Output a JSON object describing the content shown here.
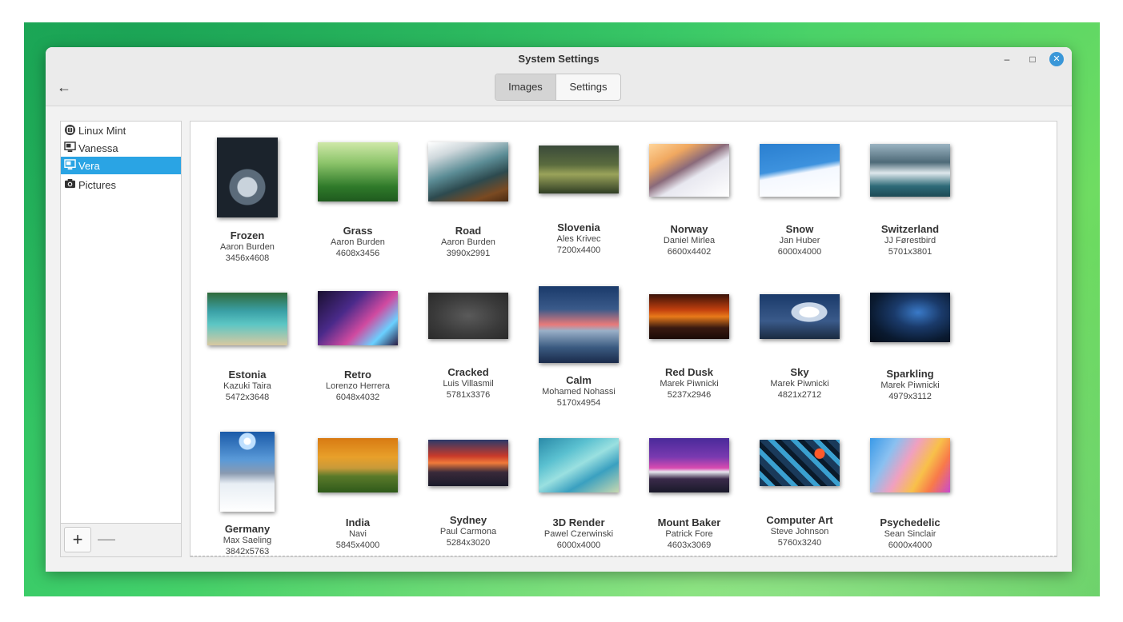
{
  "window": {
    "title": "System Settings",
    "controls": {
      "minimize": "–",
      "maximize": "□",
      "close": "✕"
    },
    "back_icon": "arrow-left-icon"
  },
  "tabs": [
    {
      "label": "Images",
      "active": true
    },
    {
      "label": "Settings",
      "active": false
    }
  ],
  "sidebar": {
    "items": [
      {
        "label": "Linux Mint",
        "icon": "linux-mint-logo-icon",
        "selected": false
      },
      {
        "label": "Vanessa",
        "icon": "monitor-icon",
        "selected": false
      },
      {
        "label": "Vera",
        "icon": "monitor-icon",
        "selected": true
      },
      {
        "label": "Pictures",
        "icon": "camera-icon",
        "selected": false
      }
    ],
    "add_label": "+",
    "remove_label": "—"
  },
  "accent_color": "#2aa4e4",
  "wallpapers": [
    {
      "name": "Frozen",
      "author": "Aaron Burden",
      "size": "3456x4608"
    },
    {
      "name": "Grass",
      "author": "Aaron Burden",
      "size": "4608x3456"
    },
    {
      "name": "Road",
      "author": "Aaron Burden",
      "size": "3990x2991"
    },
    {
      "name": "Slovenia",
      "author": "Ales Krivec",
      "size": "7200x4400"
    },
    {
      "name": "Norway",
      "author": "Daniel Mirlea",
      "size": "6600x4402"
    },
    {
      "name": "Snow",
      "author": "Jan Huber",
      "size": "6000x4000"
    },
    {
      "name": "Switzerland",
      "author": "JJ Førestbird",
      "size": "5701x3801"
    },
    {
      "name": "Estonia",
      "author": "Kazuki Taira",
      "size": "5472x3648"
    },
    {
      "name": "Retro",
      "author": "Lorenzo Herrera",
      "size": "6048x4032"
    },
    {
      "name": "Cracked",
      "author": "Luis Villasmil",
      "size": "5781x3376"
    },
    {
      "name": "Calm",
      "author": "Mohamed Nohassi",
      "size": "5170x4954"
    },
    {
      "name": "Red Dusk",
      "author": "Marek Piwnicki",
      "size": "5237x2946"
    },
    {
      "name": "Sky",
      "author": "Marek Piwnicki",
      "size": "4821x2712"
    },
    {
      "name": "Sparkling",
      "author": "Marek Piwnicki",
      "size": "4979x3112"
    },
    {
      "name": "Germany",
      "author": "Max Saeling",
      "size": "3842x5763"
    },
    {
      "name": "India",
      "author": "Navi",
      "size": "5845x4000"
    },
    {
      "name": "Sydney",
      "author": "Paul Carmona",
      "size": "5284x3020"
    },
    {
      "name": "3D Render",
      "author": "Pawel Czerwinski",
      "size": "6000x4000"
    },
    {
      "name": "Mount Baker",
      "author": "Patrick Fore",
      "size": "4603x3069"
    },
    {
      "name": "Computer Art",
      "author": "Steve Johnson",
      "size": "5760x3240"
    },
    {
      "name": "Psychedelic",
      "author": "Sean Sinclair",
      "size": "6000x4000"
    }
  ]
}
